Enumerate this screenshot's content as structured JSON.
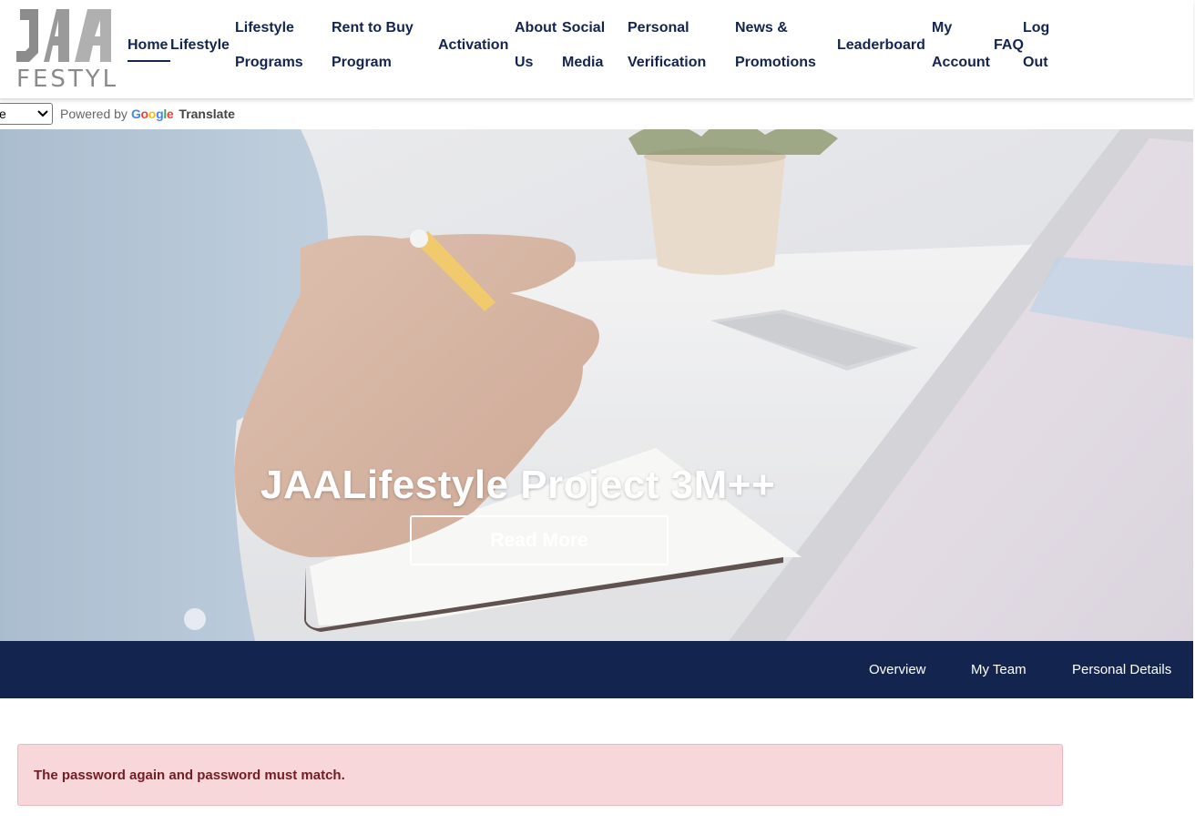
{
  "logo": {
    "text": "FESTYL",
    "mark": "JAA"
  },
  "nav": {
    "home": "Home",
    "lifestyle": "Lifestyle",
    "lifestyle_programs": [
      "Lifestyle",
      "Programs"
    ],
    "rent_to_buy": [
      "Rent to Buy",
      "Program"
    ],
    "activation": "Activation",
    "about_us": [
      "About",
      "Us"
    ],
    "social_media": [
      "Social",
      "Media"
    ],
    "personal_verification": [
      "Personal",
      "Verification"
    ],
    "news_promotions": [
      "News &",
      "Promotions"
    ],
    "leaderboard": "Leaderboard",
    "my_account": [
      "My",
      "Account"
    ],
    "faq": "FAQ",
    "log_out": [
      "Log",
      "Out"
    ]
  },
  "translate": {
    "selected_language": "e",
    "powered_by": "Powered by",
    "google": "Google",
    "translate_label": "Translate"
  },
  "hero": {
    "title": "JAALifestyle Project 3M++",
    "button": "Read More"
  },
  "subnav": {
    "overview": "Overview",
    "my_team": "My Team",
    "personal_details": "Personal Details"
  },
  "alert": {
    "message": "The password again and password must match."
  },
  "colors": {
    "navy": "#13254f",
    "alert_bg": "#f8d7da",
    "alert_text": "#721c24"
  }
}
